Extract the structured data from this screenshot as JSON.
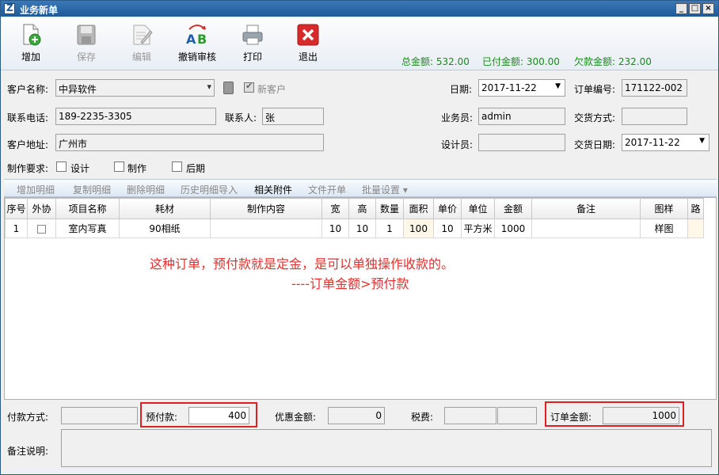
{
  "window": {
    "title": "业务新单",
    "min": "_",
    "max": "□",
    "close": "×"
  },
  "toolbar": {
    "add": "增加",
    "save": "保存",
    "edit": "编辑",
    "unreview": "撤销审核",
    "print": "打印",
    "exit": "退出"
  },
  "summary": {
    "total": "总金额: 532.00",
    "paid": "已付金额: 300.00",
    "owed": "欠款金额: 232.00"
  },
  "form": {
    "customer_label": "客户名称:",
    "customer_value": "中异软件",
    "new_customer_label": "新客户",
    "date_label": "日期:",
    "date_value": "2017-11-22",
    "order_no_label": "订单编号:",
    "order_no_value": "171122-002",
    "phone_label": "联系电话:",
    "phone_value": "189-2235-3305",
    "contact_label": "联系人:",
    "contact_value": "张",
    "salesman_label": "业务员:",
    "salesman_value": "admin",
    "delivery_method_label": "交货方式:",
    "delivery_method_value": "",
    "address_label": "客户地址:",
    "address_value": "广州市",
    "designer_label": "设计员:",
    "designer_value": "",
    "delivery_date_label": "交货日期:",
    "delivery_date_value": "2017-11-22",
    "requirement_label": "制作要求:",
    "req_design": "设计",
    "req_make": "制作",
    "req_post": "后期"
  },
  "subtoolbar": {
    "add_detail": "增加明细",
    "copy_detail": "复制明细",
    "delete_detail": "删除明细",
    "import_history": "历史明细导入",
    "attachments": "相关附件",
    "file_order": "文件开单",
    "batch_settings": "批量设置 ▾"
  },
  "table": {
    "headers": [
      "序号",
      "外协",
      "项目名称",
      "耗材",
      "制作内容",
      "宽",
      "高",
      "数量",
      "面积",
      "单价",
      "单位",
      "金额",
      "备注",
      "图样",
      "路"
    ],
    "rows": [
      [
        "1",
        "",
        "室内写真",
        "90相纸",
        "",
        "10",
        "10",
        "1",
        "100",
        "10",
        "平方米",
        "1000",
        "",
        "样图",
        ""
      ]
    ]
  },
  "annotation": {
    "line1": "这种订单，预付款就是定金，是可以单独操作收款的。",
    "line2": "----订单金额>预付款"
  },
  "bottom": {
    "payment_method_label": "付款方式:",
    "payment_method_value": "",
    "prepay_label": "预付款:",
    "prepay_value": "400",
    "discount_label": "优惠金额:",
    "discount_value": "0",
    "tax_label": "税费:",
    "tax_value1": "",
    "tax_value2": "",
    "order_amount_label": "订单金额:",
    "order_amount_value": "1000",
    "remark_label": "备注说明:",
    "remark_value": ""
  },
  "colors": {
    "accent": "#1f5a98",
    "summary_green": "#1a8a1a",
    "annotation_red": "#e03030"
  }
}
